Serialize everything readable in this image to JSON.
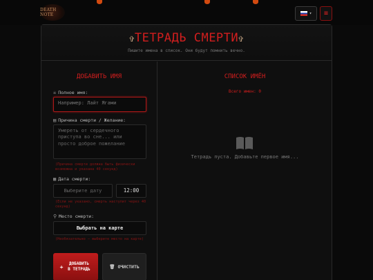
{
  "header": {
    "logo_text": "DEATH NOTE",
    "lang_caret": "▾",
    "menu_icon": "≡",
    "title": "ТЕТРАДЬ СМЕРТИ",
    "subtitle": "Пишите имена в список. Они будут помнить вечно."
  },
  "form": {
    "section_title": "ДОБАВИТЬ ИМЯ",
    "name_label": "Полное имя:",
    "name_placeholder": "Например: Лайт Ягами",
    "cause_label": "Причина смерти / Желание:",
    "cause_placeholder": "Умереть от сердечного приступа во сне... или просто доброе пожелание",
    "cause_hint": "(Причина смерти должна быть физически возможна и указана 40 секунд)",
    "date_label": "Дата смерти:",
    "date_placeholder": "Выберите дату",
    "time_value": "12:00",
    "date_hint": "(Если не указано, смерть наступит через 40 секунд)",
    "place_label": "Место смерти:",
    "map_button": "Выбрать на карте",
    "place_hint": "(Необязательно — выберите место на карте)",
    "add_button": "ДОБАВИТЬ В ТЕТРАДЬ",
    "clear_button": "ОЧИСТИТЬ"
  },
  "list": {
    "section_title": "СПИСОК ИМЁН",
    "count": "Всего имен: 0",
    "empty_text": "Тетрадь пуста. Добавьте первое имя..."
  },
  "colors": {
    "accent": "#d21e1e",
    "background": "#0a0a0a"
  },
  "icons": {
    "name": "skull-icon",
    "cause": "note-icon",
    "date": "calendar-icon",
    "place": "map-pin-icon",
    "add": "plus-icon",
    "clear": "trash-icon",
    "empty": "book-icon"
  }
}
